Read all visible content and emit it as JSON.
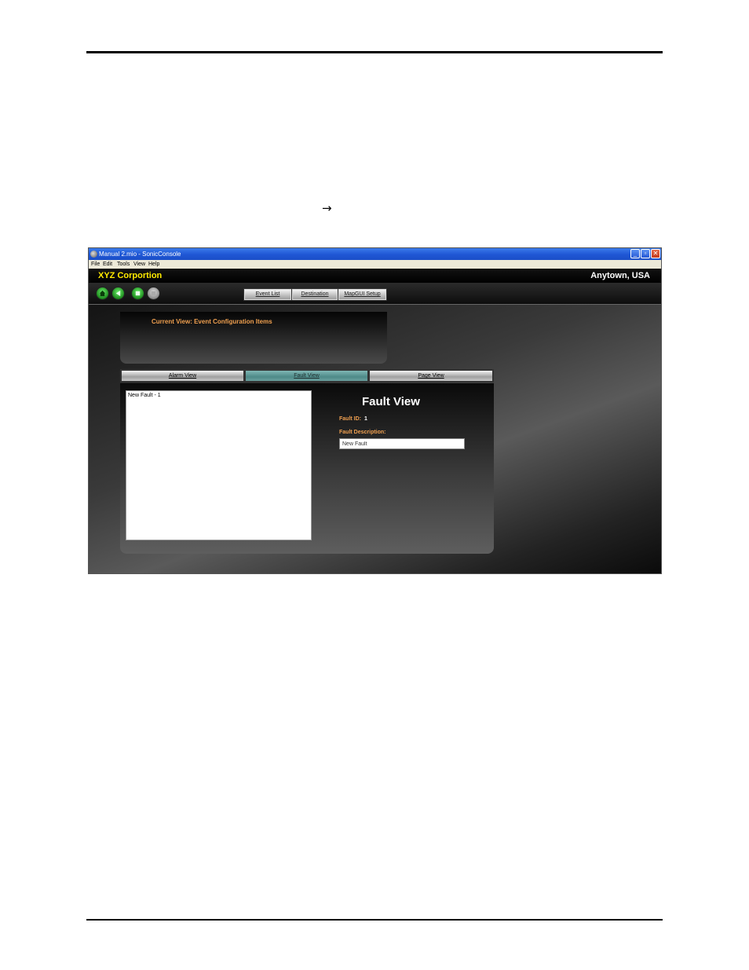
{
  "window": {
    "title": "Manual 2.mio - SonicConsole",
    "controls": {
      "minimize": "_",
      "restore": "▫",
      "close": "✕"
    }
  },
  "menu": [
    "File",
    "Edit",
    "Tools",
    "View",
    "Help"
  ],
  "header": {
    "company": "XYZ Corportion",
    "location": "Anytown, USA"
  },
  "toolbar": {
    "icons": [
      "home-icon",
      "back-icon",
      "stop-icon",
      "disabled-icon"
    ],
    "buttons": [
      "Event List",
      "Destination",
      "MapGUI Setup"
    ]
  },
  "current_view": "Current View: Event Configuration Items",
  "tabs": [
    {
      "label": "Alarm View",
      "active": false
    },
    {
      "label": "Fault View",
      "active": true
    },
    {
      "label": "Page View",
      "active": false
    }
  ],
  "fault_list": [
    "New Fault - 1"
  ],
  "fault_view": {
    "title": "Fault View",
    "id_label": "Fault ID:",
    "id_value": "1",
    "description_label": "Fault Description:",
    "description_value": "New Fault"
  },
  "colors": {
    "accent_orange": "#f0a050",
    "company_yellow": "#ffea00",
    "active_tab": "#5f9c9a"
  }
}
